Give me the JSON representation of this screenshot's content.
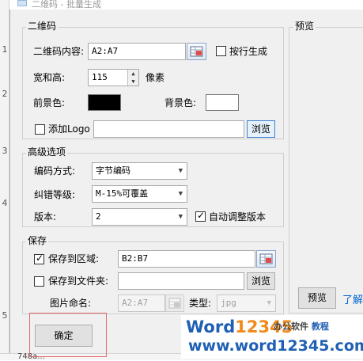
{
  "window": {
    "title": "二维码 - 批量生成"
  },
  "sheet": {
    "row_labels": [
      "1",
      "2",
      "3",
      "4",
      "5"
    ],
    "bottom_text": "748a..."
  },
  "qr": {
    "legend": "二维码",
    "content_label": "二维码内容:",
    "content_value": "A2:A7",
    "by_row_label": "按行生成",
    "by_row_checked": false,
    "size_label": "宽和高:",
    "size_value": "115",
    "size_unit": "像素",
    "fg_label": "前景色:",
    "fg_color": "#000000",
    "bg_label": "背景色:",
    "bg_color": "#ffffff",
    "logo_label": "添加Logo",
    "logo_checked": false,
    "logo_path": "",
    "browse_label": "浏览"
  },
  "advanced": {
    "legend": "高级选项",
    "encoding_label": "编码方式:",
    "encoding_value": "字节编码",
    "ecc_label": "纠错等级:",
    "ecc_value": "M-15%可覆盖",
    "version_label": "版本:",
    "version_value": "2",
    "auto_version_label": "自动调整版本",
    "auto_version_checked": true
  },
  "save": {
    "legend": "保存",
    "to_range_label": "保存到区域:",
    "to_range_checked": true,
    "range_value": "B2:B7",
    "to_folder_label": "保存到文件夹:",
    "to_folder_checked": false,
    "folder_path": "",
    "browse_label": "浏览",
    "image_name_label": "图片命名:",
    "image_name_value": "A2:A7",
    "type_label": "类型:",
    "type_value": "jpg"
  },
  "preview": {
    "legend": "预览",
    "button_label": "预览",
    "learn_more_label": "了解"
  },
  "confirm_label": "确定",
  "watermark": {
    "word": "Word",
    "num": "12345",
    "tag_office": "办公软件",
    "tag_tutorial": "教程",
    "url": "www.word12345.com"
  }
}
